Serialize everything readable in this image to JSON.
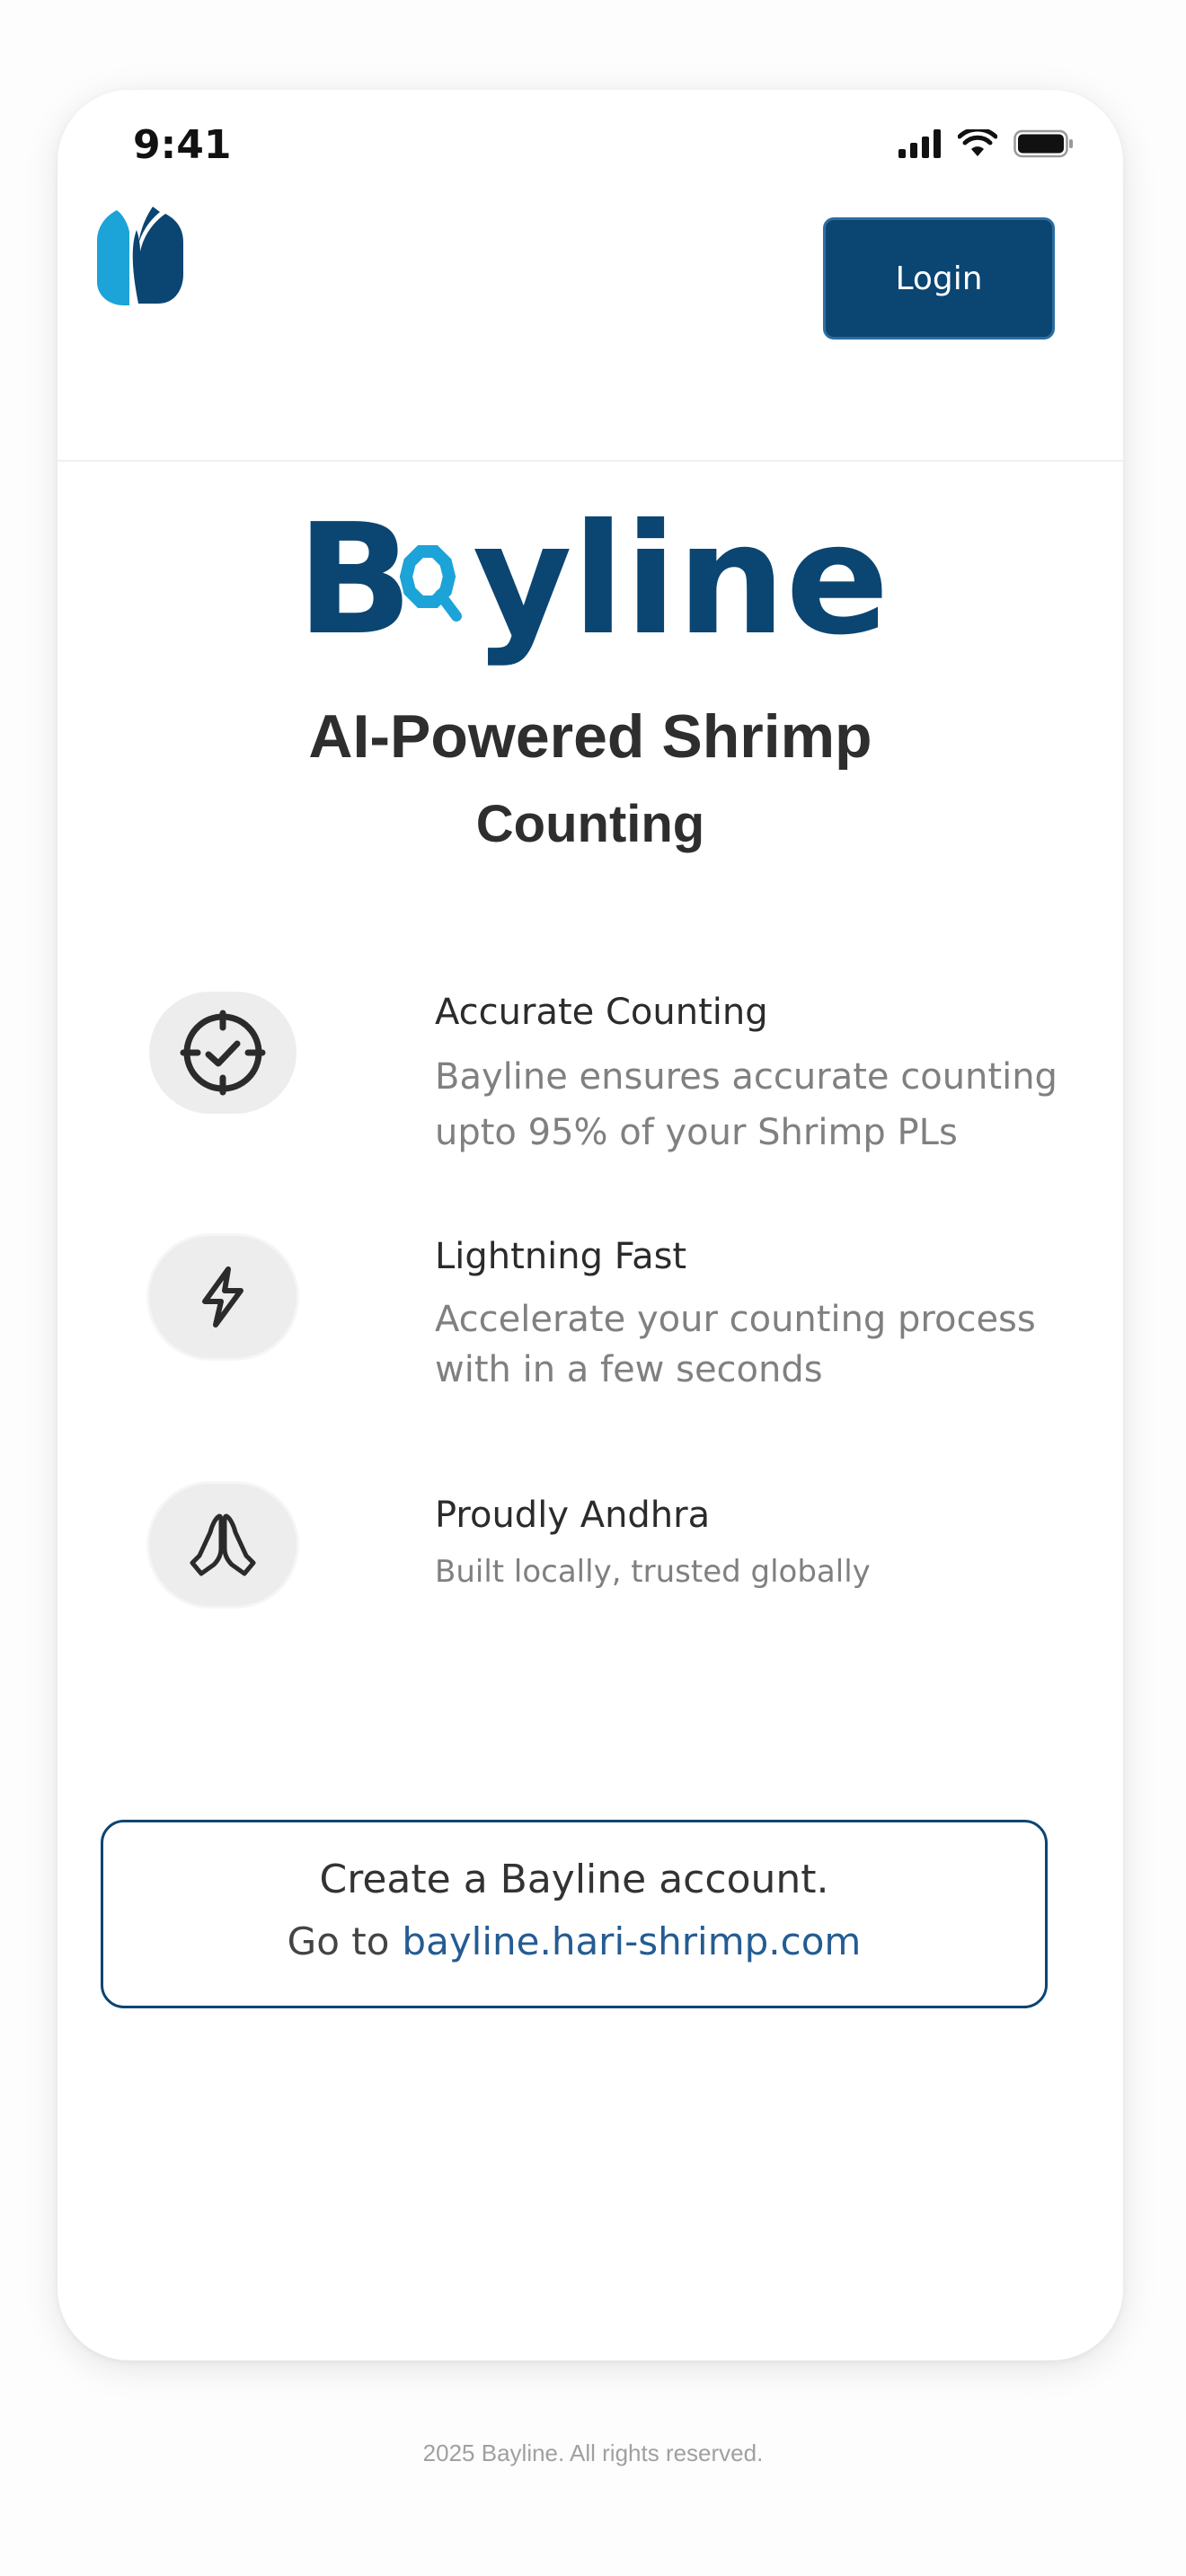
{
  "status_bar": {
    "time": "9:41",
    "icons": [
      "signal-icon",
      "wifi-icon",
      "battery-icon"
    ]
  },
  "header": {
    "logo_icon": "bayline-logo-icon",
    "login_label": "Login"
  },
  "brand": {
    "wordmark": "Bayline",
    "colors": {
      "navy": "#0b4572",
      "cyan": "#1ca3d8"
    }
  },
  "headline": {
    "line1": "AI-Powered Shrimp",
    "line2": "Counting"
  },
  "features": [
    {
      "icon": "target-check-icon",
      "title": "Accurate Counting",
      "description_line1": "Bayline ensures accurate counting",
      "description_line2": "upto 95% of your Shrimp PLs"
    },
    {
      "icon": "lightning-icon",
      "title": "Lightning Fast",
      "description_line1": "Accelerate your counting process",
      "description_line2": "with in a few seconds"
    },
    {
      "icon": "praying-hands-icon",
      "title": "Proudly Andhra",
      "description_line1": "Built locally, trusted globally"
    }
  ],
  "cta": {
    "line1": "Create a Bayline account.",
    "go_to": "Go to",
    "link": "bayline.hari-shrimp.com"
  },
  "footer": {
    "text": "2025 Bayline. All rights reserved."
  }
}
